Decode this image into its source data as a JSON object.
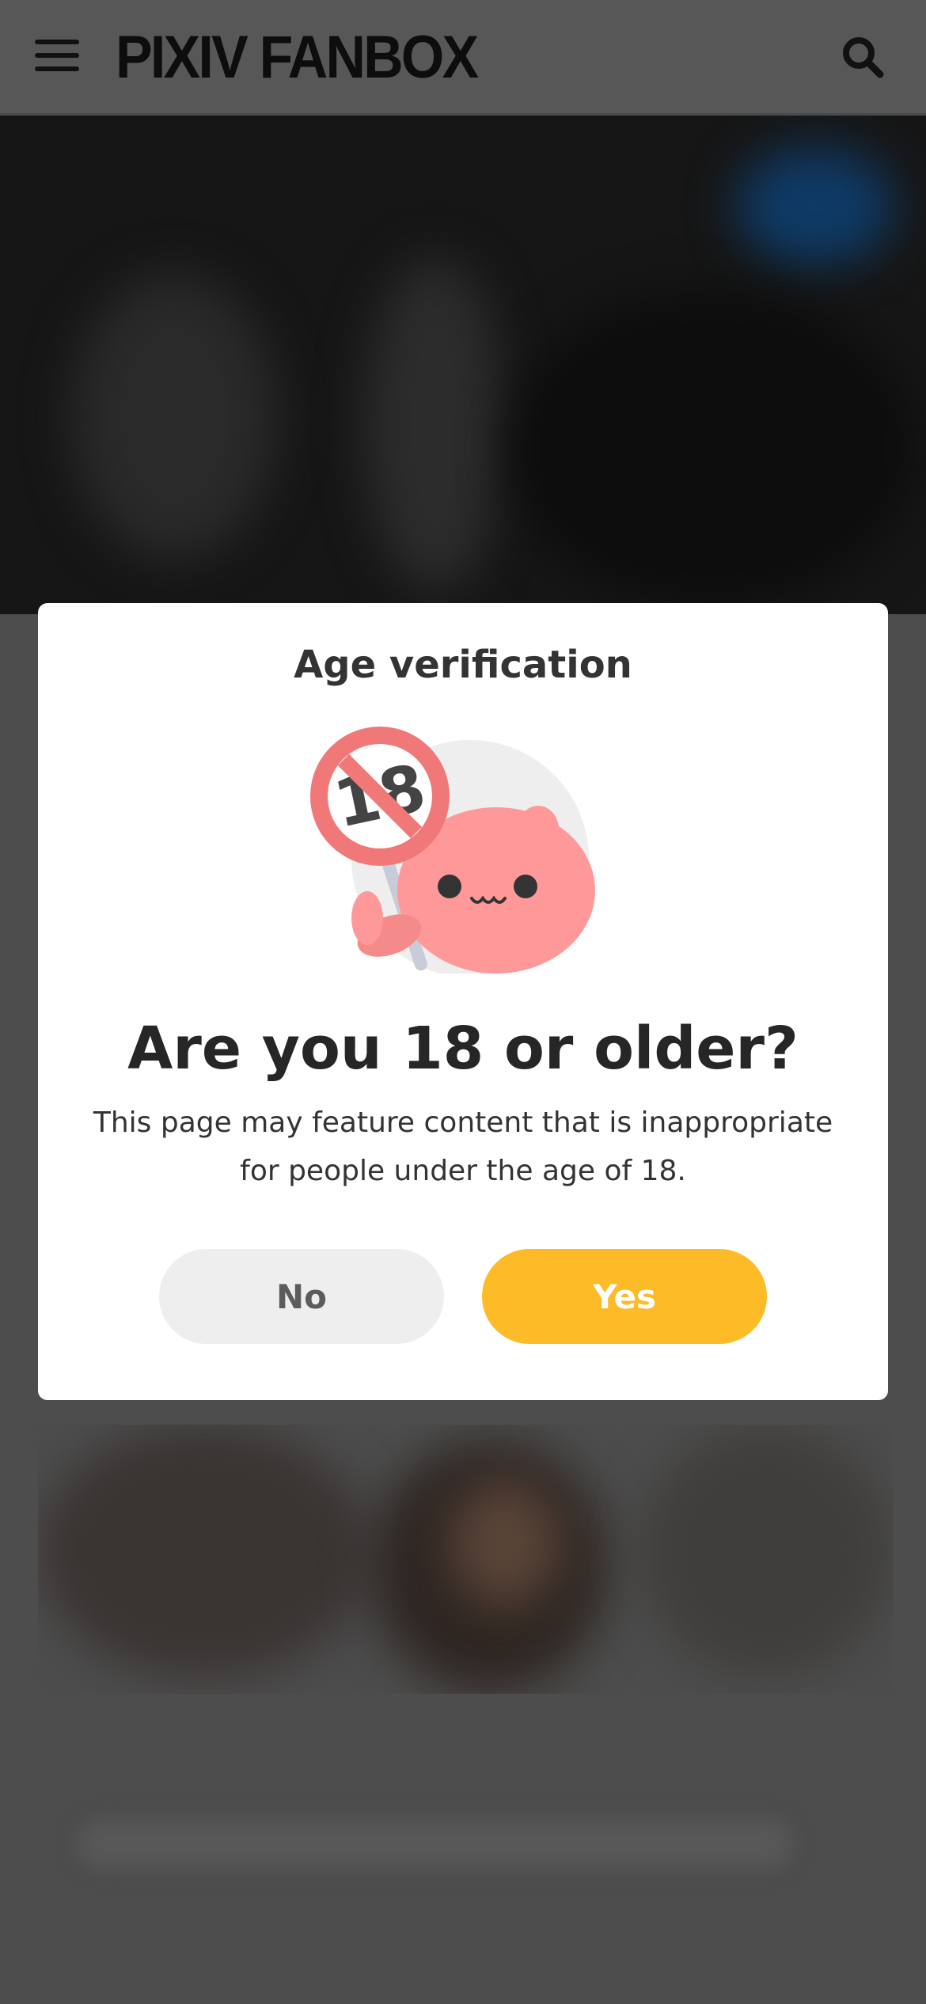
{
  "header": {
    "logo_text": "PIXIV FANBOX",
    "menu_icon": "hamburger-menu-icon",
    "search_icon": "search-icon"
  },
  "dialog": {
    "title": "Age verification",
    "illustration": "pink-mascot-holding-no-under-18-sign",
    "sign_text": "18",
    "heading": "Are you 18 or older?",
    "description": "This page may feature content that is inappropriate for people under the age of 18.",
    "no_label": "No",
    "yes_label": "Yes"
  },
  "colors": {
    "accent_yes": "#fcbb27",
    "no_button_bg": "#eeeeee",
    "mascot_pink": "#ff9999",
    "sign_red": "#f07878",
    "overlay_gray": "#4d4d4d"
  }
}
